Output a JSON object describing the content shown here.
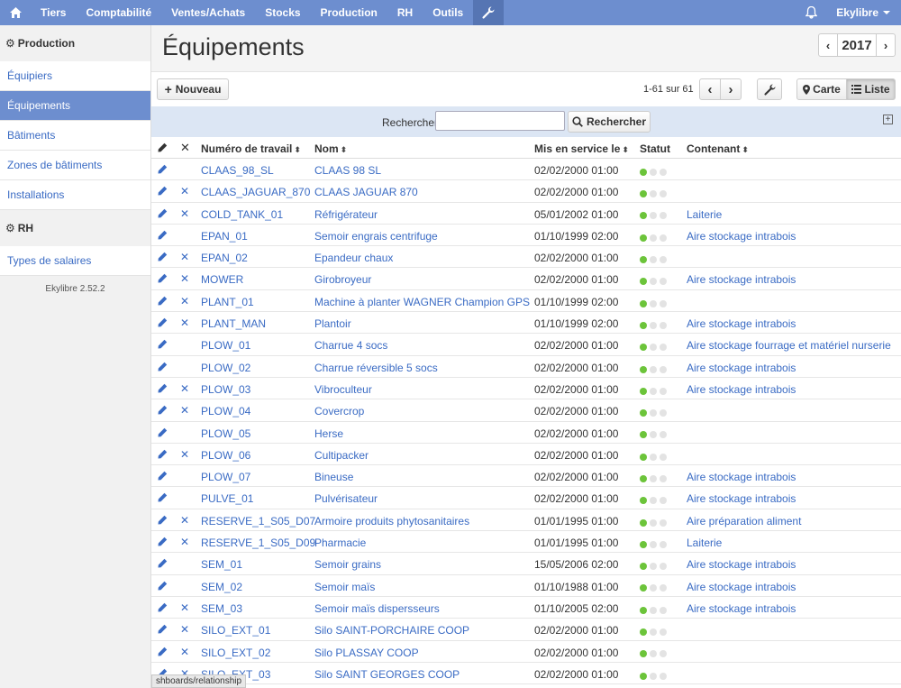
{
  "topbar": {
    "items": [
      "Tiers",
      "Comptabilité",
      "Ventes/Achats",
      "Stocks",
      "Production",
      "RH",
      "Outils"
    ],
    "user": "Ekylibre"
  },
  "sidebar": {
    "sections": [
      {
        "title": "Production",
        "items": [
          {
            "label": "Équipiers",
            "active": false
          },
          {
            "label": "Équipements",
            "active": true
          },
          {
            "label": "Bâtiments",
            "active": false
          },
          {
            "label": "Zones de bâtiments",
            "active": false
          },
          {
            "label": "Installations",
            "active": false
          }
        ]
      },
      {
        "title": "RH",
        "items": [
          {
            "label": "Types de salaires",
            "active": false
          }
        ]
      }
    ],
    "version": "Ekylibre 2.52.2"
  },
  "header": {
    "title": "Équipements",
    "year": "2017"
  },
  "toolbar": {
    "new_label": "Nouveau",
    "pagination": "1-61 sur 61",
    "map_label": "Carte",
    "list_label": "Liste"
  },
  "search": {
    "label": "Rechercher",
    "value": "",
    "button": "Rechercher"
  },
  "table": {
    "columns": [
      "Numéro de travail",
      "Nom",
      "Mis en service le",
      "Statut",
      "Contenant"
    ],
    "rows": [
      {
        "code": "CLAAS_98_SL",
        "name": "CLAAS 98 SL",
        "date": "02/02/2000 01:00",
        "container": "",
        "deletable": false
      },
      {
        "code": "CLAAS_JAGUAR_870",
        "name": "CLAAS JAGUAR 870",
        "date": "02/02/2000 01:00",
        "container": "",
        "deletable": true
      },
      {
        "code": "COLD_TANK_01",
        "name": "Réfrigérateur",
        "date": "05/01/2002 01:00",
        "container": "Laiterie",
        "deletable": true
      },
      {
        "code": "EPAN_01",
        "name": "Semoir engrais centrifuge",
        "date": "01/10/1999 02:00",
        "container": "Aire stockage intrabois",
        "deletable": false
      },
      {
        "code": "EPAN_02",
        "name": "Epandeur chaux",
        "date": "02/02/2000 01:00",
        "container": "",
        "deletable": true
      },
      {
        "code": "MOWER",
        "name": "Girobroyeur",
        "date": "02/02/2000 01:00",
        "container": "Aire stockage intrabois",
        "deletable": true
      },
      {
        "code": "PLANT_01",
        "name": "Machine à planter WAGNER Champion GPS",
        "date": "01/10/1999 02:00",
        "container": "",
        "deletable": true
      },
      {
        "code": "PLANT_MAN",
        "name": "Plantoir",
        "date": "01/10/1999 02:00",
        "container": "Aire stockage intrabois",
        "deletable": true
      },
      {
        "code": "PLOW_01",
        "name": "Charrue 4 socs",
        "date": "02/02/2000 01:00",
        "container": "Aire stockage fourrage et matériel nurserie",
        "deletable": false
      },
      {
        "code": "PLOW_02",
        "name": "Charrue réversible 5 socs",
        "date": "02/02/2000 01:00",
        "container": "Aire stockage intrabois",
        "deletable": false
      },
      {
        "code": "PLOW_03",
        "name": "Vibroculteur",
        "date": "02/02/2000 01:00",
        "container": "Aire stockage intrabois",
        "deletable": true
      },
      {
        "code": "PLOW_04",
        "name": "Covercrop",
        "date": "02/02/2000 01:00",
        "container": "",
        "deletable": true
      },
      {
        "code": "PLOW_05",
        "name": "Herse",
        "date": "02/02/2000 01:00",
        "container": "",
        "deletable": false
      },
      {
        "code": "PLOW_06",
        "name": "Cultipacker",
        "date": "02/02/2000 01:00",
        "container": "",
        "deletable": true
      },
      {
        "code": "PLOW_07",
        "name": "Bineuse",
        "date": "02/02/2000 01:00",
        "container": "Aire stockage intrabois",
        "deletable": false
      },
      {
        "code": "PULVE_01",
        "name": "Pulvérisateur",
        "date": "02/02/2000 01:00",
        "container": "Aire stockage intrabois",
        "deletable": false
      },
      {
        "code": "RESERVE_1_S05_D07",
        "name": "Armoire produits phytosanitaires",
        "date": "01/01/1995 01:00",
        "container": "Aire préparation aliment",
        "deletable": true
      },
      {
        "code": "RESERVE_1_S05_D09",
        "name": "Pharmacie",
        "date": "01/01/1995 01:00",
        "container": "Laiterie",
        "deletable": true
      },
      {
        "code": "SEM_01",
        "name": "Semoir grains",
        "date": "15/05/2006 02:00",
        "container": "Aire stockage intrabois",
        "deletable": false
      },
      {
        "code": "SEM_02",
        "name": "Semoir maïs",
        "date": "01/10/1988 01:00",
        "container": "Aire stockage intrabois",
        "deletable": false
      },
      {
        "code": "SEM_03",
        "name": "Semoir maïs dispersseurs",
        "date": "01/10/2005 02:00",
        "container": "Aire stockage intrabois",
        "deletable": true
      },
      {
        "code": "SILO_EXT_01",
        "name": "Silo SAINT-PORCHAIRE COOP",
        "date": "02/02/2000 01:00",
        "container": "",
        "deletable": true
      },
      {
        "code": "SILO_EXT_02",
        "name": "Silo PLASSAY COOP",
        "date": "02/02/2000 01:00",
        "container": "",
        "deletable": true
      },
      {
        "code": "SILO_EXT_03",
        "name": "Silo SAINT GEORGES COOP",
        "date": "02/02/2000 01:00",
        "container": "",
        "deletable": true
      }
    ]
  },
  "statusbar": "shboards/relationship",
  "colors": {
    "topbar": "#6d8ecf",
    "active": "#6d8ecf",
    "link": "#3a6bc4",
    "status_on": "#6cc43a",
    "status_off": "#e3e3e3"
  }
}
